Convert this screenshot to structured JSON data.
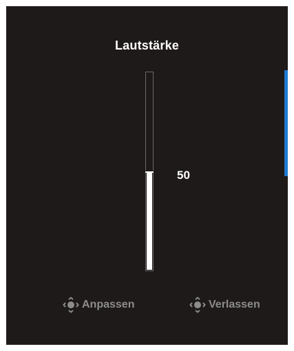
{
  "osd": {
    "title": "Lautstärke",
    "volume": {
      "value": 50,
      "value_label": "50",
      "min": 0,
      "max": 100
    },
    "hints": [
      {
        "icon": "joystick-icon",
        "label": "Anpassen"
      },
      {
        "icon": "joystick-icon",
        "label": "Verlassen"
      }
    ]
  },
  "colors": {
    "panel_background": "#1e1a19",
    "accent": "#1f7bd1",
    "text_primary": "#ffffff",
    "text_hint": "#8c8c8c"
  }
}
